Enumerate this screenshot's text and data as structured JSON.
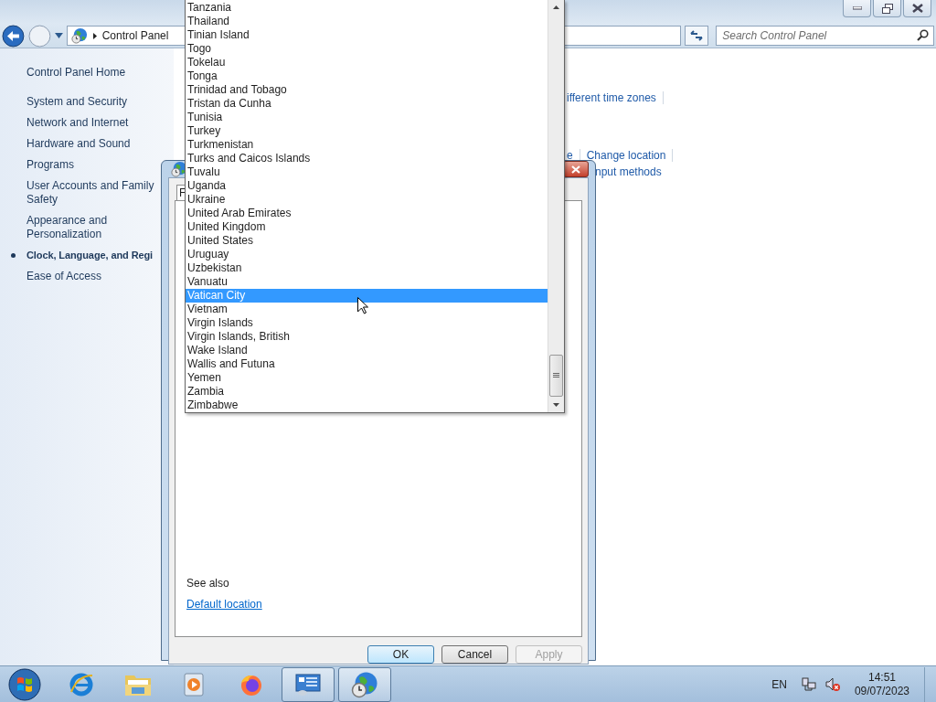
{
  "control_panel": {
    "breadcrumb": "Control Panel",
    "search": {
      "placeholder": "Search Control Panel"
    },
    "sidebar": {
      "home": "Control Panel Home",
      "items": [
        {
          "label": "System and Security",
          "selected": false
        },
        {
          "label": "Network and Internet",
          "selected": false
        },
        {
          "label": "Hardware and Sound",
          "selected": false
        },
        {
          "label": "Programs",
          "selected": false
        },
        {
          "label": "User Accounts and Family Safety",
          "selected": false
        },
        {
          "label": "Appearance and Personalization",
          "selected": false
        },
        {
          "label": "Clock, Language, and Regi",
          "selected": true
        },
        {
          "label": "Ease of Access",
          "selected": false
        }
      ]
    },
    "content_rows": [
      [
        "ifferent time zones"
      ],
      [
        "e",
        "Change location"
      ],
      [
        "nput methods"
      ]
    ]
  },
  "dialog": {
    "tab": "F",
    "see_also": "See also",
    "link": "Default location",
    "buttons": [
      {
        "label": "OK",
        "default": true,
        "disabled": false
      },
      {
        "label": "Cancel",
        "default": false,
        "disabled": false
      },
      {
        "label": "Apply",
        "default": false,
        "disabled": true
      }
    ]
  },
  "dropdown": {
    "items": [
      {
        "label": "Tanzania",
        "selected": false
      },
      {
        "label": "Thailand",
        "selected": false
      },
      {
        "label": "Tinian Island",
        "selected": false
      },
      {
        "label": "Togo",
        "selected": false
      },
      {
        "label": "Tokelau",
        "selected": false
      },
      {
        "label": "Tonga",
        "selected": false
      },
      {
        "label": "Trinidad and Tobago",
        "selected": false
      },
      {
        "label": "Tristan da Cunha",
        "selected": false
      },
      {
        "label": "Tunisia",
        "selected": false
      },
      {
        "label": "Turkey",
        "selected": false
      },
      {
        "label": "Turkmenistan",
        "selected": false
      },
      {
        "label": "Turks and Caicos Islands",
        "selected": false
      },
      {
        "label": "Tuvalu",
        "selected": false
      },
      {
        "label": "Uganda",
        "selected": false
      },
      {
        "label": "Ukraine",
        "selected": false
      },
      {
        "label": "United Arab Emirates",
        "selected": false
      },
      {
        "label": "United Kingdom",
        "selected": false
      },
      {
        "label": "United States",
        "selected": false
      },
      {
        "label": "Uruguay",
        "selected": false
      },
      {
        "label": "Uzbekistan",
        "selected": false
      },
      {
        "label": "Vanuatu",
        "selected": false
      },
      {
        "label": "Vatican City",
        "selected": true
      },
      {
        "label": "Vietnam",
        "selected": false
      },
      {
        "label": "Virgin Islands",
        "selected": false
      },
      {
        "label": "Virgin Islands, British",
        "selected": false
      },
      {
        "label": "Wake Island",
        "selected": false
      },
      {
        "label": "Wallis and Futuna",
        "selected": false
      },
      {
        "label": "Yemen",
        "selected": false
      },
      {
        "label": "Zambia",
        "selected": false
      },
      {
        "label": "Zimbabwe",
        "selected": false
      }
    ]
  },
  "taskbar": {
    "apps": [
      {
        "kind": "browser",
        "running": false
      },
      {
        "kind": "folder",
        "running": false
      },
      {
        "kind": "media",
        "running": false
      },
      {
        "kind": "firefox",
        "running": false
      },
      {
        "kind": "control-panel",
        "running": true
      },
      {
        "kind": "clock-globe",
        "running": true
      }
    ],
    "language": "EN",
    "time": "14:51",
    "date": "09/07/2023"
  }
}
